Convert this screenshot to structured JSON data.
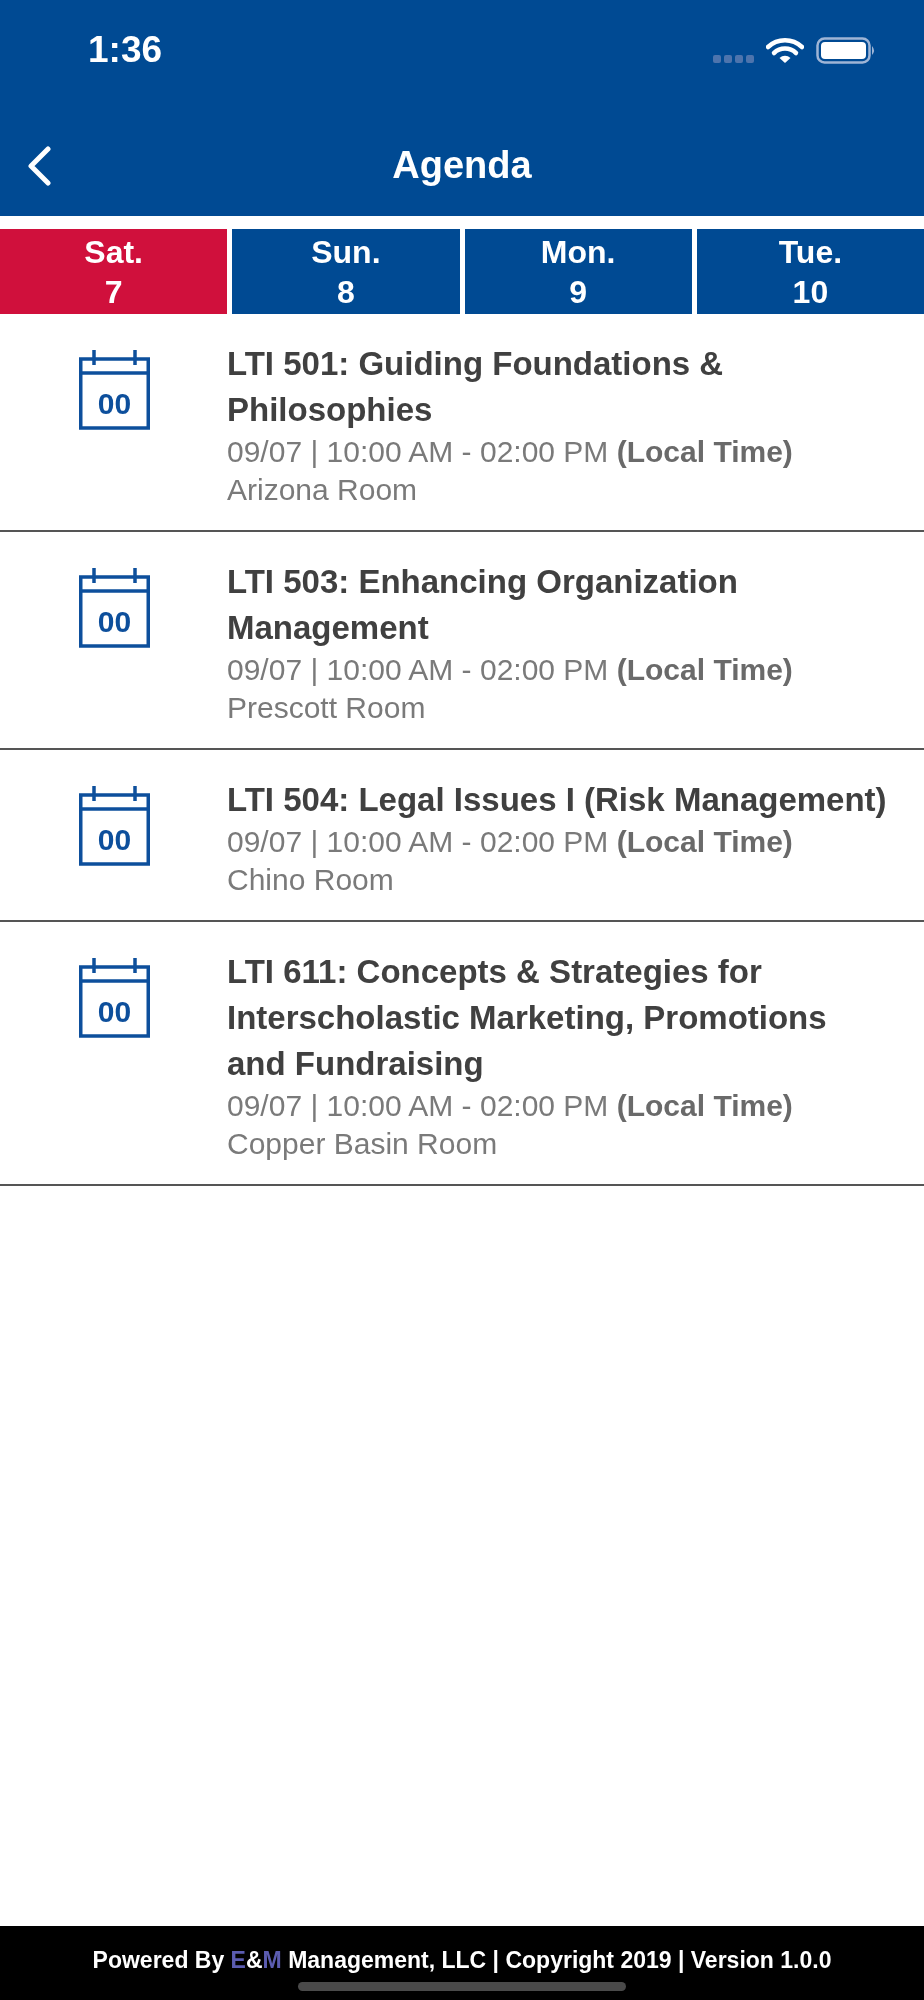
{
  "status_bar": {
    "time": "1:36"
  },
  "header": {
    "title": "Agenda"
  },
  "days": [
    {
      "weekday": "Sat.",
      "day": "7",
      "selected": true
    },
    {
      "weekday": "Sun.",
      "day": "8",
      "selected": false
    },
    {
      "weekday": "Mon.",
      "day": "9",
      "selected": false
    },
    {
      "weekday": "Tue.",
      "day": "10",
      "selected": false
    }
  ],
  "sessions": [
    {
      "icon_text": "00",
      "title": "LTI 501: Guiding Foundations & Philosophies",
      "schedule": "09/07 | 10:00 AM - 02:00 PM **(Local Time)**",
      "room": "Arizona Room"
    },
    {
      "icon_text": "00",
      "title": "LTI 503: Enhancing Organization Management",
      "schedule": "09/07 | 10:00 AM - 02:00 PM **(Local Time)**",
      "room": "Prescott Room"
    },
    {
      "icon_text": "00",
      "title": "LTI 504: Legal Issues I (Risk Management)",
      "schedule": "09/07 | 10:00 AM - 02:00 PM **(Local Time)**",
      "room": "Chino Room"
    },
    {
      "icon_text": "00",
      "title": "LTI 611: Concepts & Strategies for Interscholastic Marketing, Promotions and Fundraising",
      "schedule": "09/07 | 10:00 AM - 02:00 PM **(Local Time)**",
      "room": "Copper Basin Room"
    }
  ],
  "footer": {
    "segments": [
      {
        "text": "Powered By ",
        "highlight": false
      },
      {
        "text": "E",
        "highlight": true
      },
      {
        "text": "&",
        "highlight": false
      },
      {
        "text": "M",
        "highlight": true
      },
      {
        "text": " Management, LLC | Copyright 2019 | Version 1.0.0",
        "highlight": false
      }
    ]
  }
}
